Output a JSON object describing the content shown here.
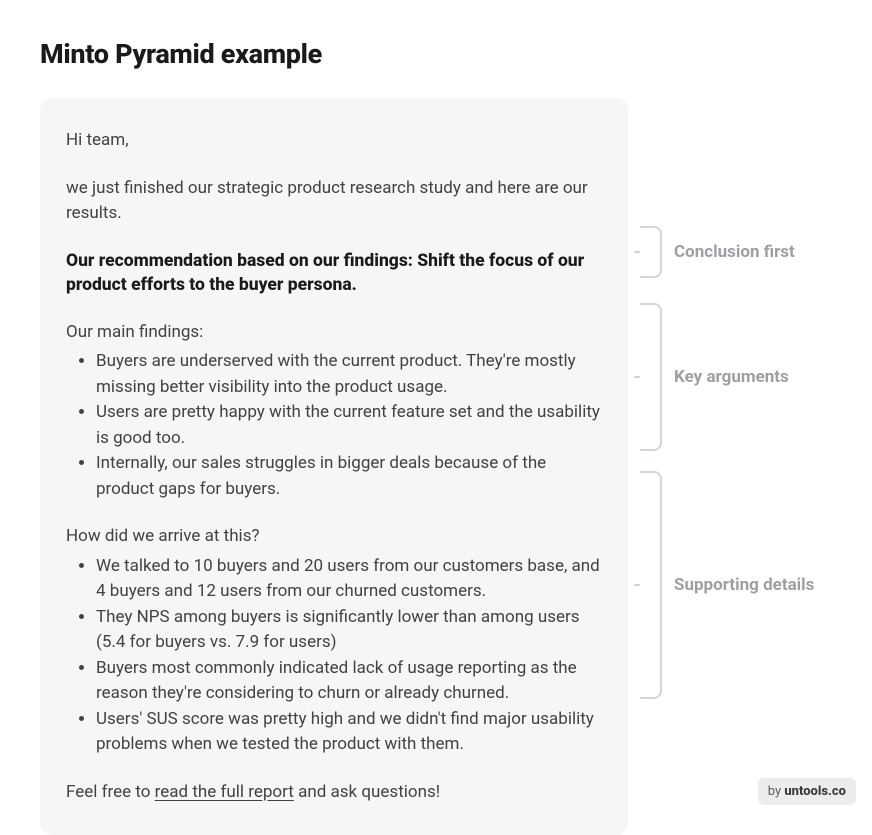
{
  "title": "Minto Pyramid example",
  "email": {
    "greeting": "Hi team,",
    "intro": "we just finished our strategic product research study and here are our results.",
    "recommendation": "Our recommendation based on our findings: Shift the focus of our product efforts to the buyer persona.",
    "findings_heading": "Our main findings:",
    "findings": [
      "Buyers are underserved with the current product. They're mostly missing better visibility into the product usage.",
      "Users are pretty happy with the current feature set and the usability is good too.",
      "Internally, our sales struggles in bigger deals because of the product gaps for buyers."
    ],
    "details_heading": "How did we arrive at this?",
    "details": [
      "We talked to 10 buyers and 20 users from our customers base, and 4 buyers and 12 users from our churned customers.",
      "They NPS among buyers is significantly lower than among users (5.4 for buyers vs. 7.9 for users)",
      "Buyers most commonly indicated lack of usage reporting as the reason they're considering to churn or already churned.",
      "Users' SUS score was pretty high and we didn't find major usability problems when we tested the product with them."
    ],
    "closing_pre": "Feel free to ",
    "closing_link": "read the full report",
    "closing_post": " and ask questions!"
  },
  "annotations": {
    "conclusion": "Conclusion first",
    "arguments": "Key arguments",
    "details": "Supporting details"
  },
  "attribution": {
    "by": "by ",
    "brand": "untools.co"
  }
}
